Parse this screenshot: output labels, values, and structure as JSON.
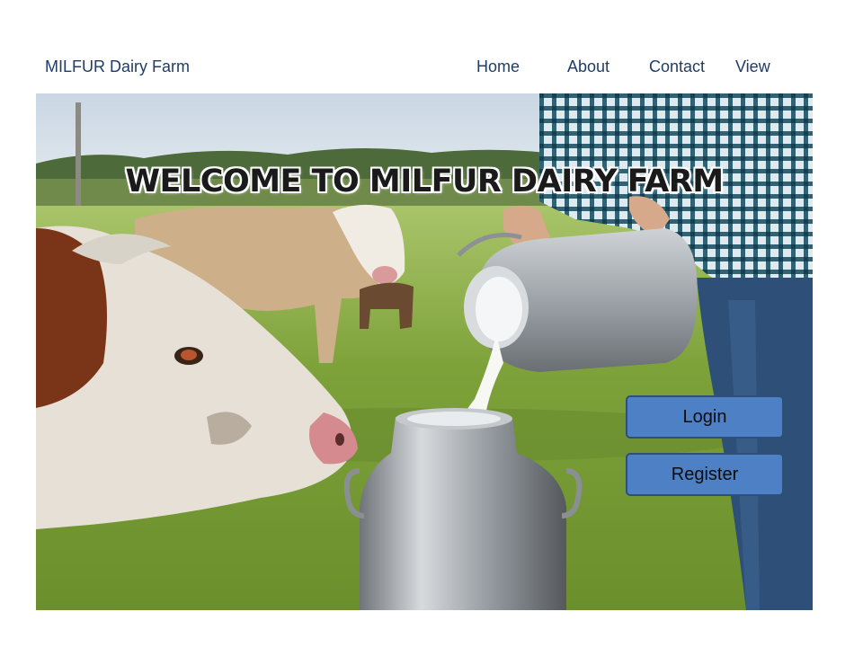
{
  "header": {
    "brand": "MILFUR Dairy Farm",
    "nav": [
      {
        "label": "Home"
      },
      {
        "label": "About"
      },
      {
        "label": "Contact"
      },
      {
        "label": "View"
      }
    ]
  },
  "hero": {
    "title": "WELCOME TO MILFUR DAIRY FARM",
    "image_alt": "cow-pasture-milk-pouring-photo"
  },
  "buttons": {
    "login": "Login",
    "register": "Register"
  },
  "colors": {
    "nav_text": "#1f3d66",
    "button_fill": "#4e80c5",
    "button_border": "#2e4f7a"
  }
}
